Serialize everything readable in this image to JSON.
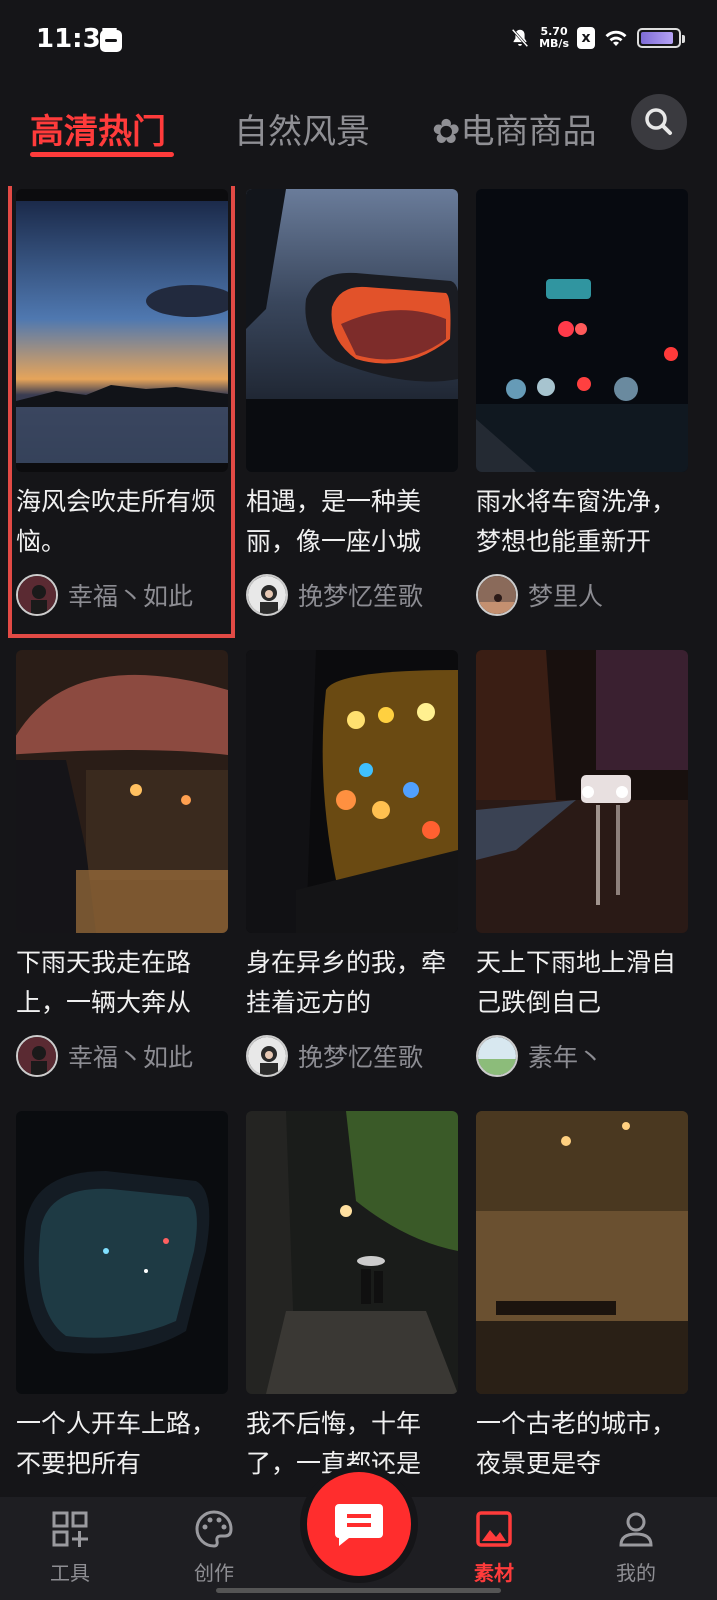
{
  "status": {
    "time": "11:37",
    "net_speed_value": "5.70",
    "net_speed_unit": "MB/s",
    "x_badge": "x"
  },
  "tabs": [
    {
      "label": "高清热门",
      "active": true
    },
    {
      "label": "自然风景",
      "active": false
    },
    {
      "label": "✿电商商品",
      "active": false
    }
  ],
  "cards": [
    {
      "caption": "海风会吹走所有烦恼。",
      "author": "幸福丶如此"
    },
    {
      "caption": "相遇，是一种美丽，像一座小城",
      "author": "挽梦忆笙歌"
    },
    {
      "caption": "雨水将车窗洗净，梦想也能重新开",
      "author": "梦里人"
    },
    {
      "caption": "下雨天我走在路上，一辆大奔从",
      "author": "幸福丶如此"
    },
    {
      "caption": "身在异乡的我，牵挂着远方的",
      "author": "挽梦忆笙歌"
    },
    {
      "caption": "天上下雨地上滑自己跌倒自己",
      "author": "素年丶"
    },
    {
      "caption": "一个人开车上路，不要把所有",
      "author": ""
    },
    {
      "caption": "我不后悔，十年了，一直都还是",
      "author": ""
    },
    {
      "caption": "一个古老的城市，夜景更是夺",
      "author": ""
    }
  ],
  "nav": [
    {
      "label": "工具",
      "icon": "grid-plus-icon",
      "active": false
    },
    {
      "label": "创作",
      "icon": "palette-icon",
      "active": false
    },
    {
      "label": "",
      "icon": "chat-icon",
      "active": false
    },
    {
      "label": "素材",
      "icon": "image-icon",
      "active": true
    },
    {
      "label": "我的",
      "icon": "user-icon",
      "active": false
    }
  ],
  "colors": {
    "accent": "#ff3b3b",
    "background": "#151518",
    "highlight_border": "#e24a45"
  }
}
